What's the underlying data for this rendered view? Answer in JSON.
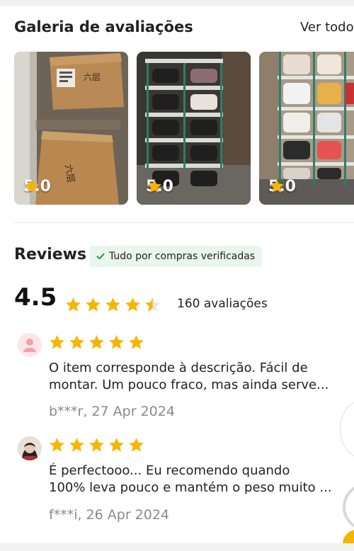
{
  "gallery": {
    "title": "Galeria de avaliações",
    "view_all": "Ver todos",
    "items": [
      {
        "rating": "5.0",
        "image": "cardboard-boxes-photo"
      },
      {
        "rating": "5.0",
        "image": "shoe-rack-black-shoes-photo"
      },
      {
        "rating": "5.0",
        "image": "shoe-rack-sneakers-photo"
      }
    ]
  },
  "reviews": {
    "title": "Reviews",
    "verified_label": "Tudo por compras verificadas",
    "average": "4.5",
    "average_stars": 4.5,
    "count_label": "160 avaliações",
    "items": [
      {
        "avatar": "default-user-avatar",
        "stars": 5,
        "text_line1": "O item corresponde à descrição. Fácil de",
        "text_line2": "montar. Um pouco fraco, mas ainda serve...",
        "meta": "b***r, 27 Apr 2024"
      },
      {
        "avatar": "user-photo-avatar",
        "stars": 5,
        "text_line1": "É perfectooo... Eu recomendo quando",
        "text_line2": "100% leva pouco e mantém o peso muito ...",
        "meta": "f***i, 26 Apr 2024"
      }
    ]
  },
  "colors": {
    "star": "#f7b500",
    "verified_bg": "#e9f6ee",
    "verified_check": "#1a9a4a",
    "meta_text": "#8a8a8a"
  }
}
